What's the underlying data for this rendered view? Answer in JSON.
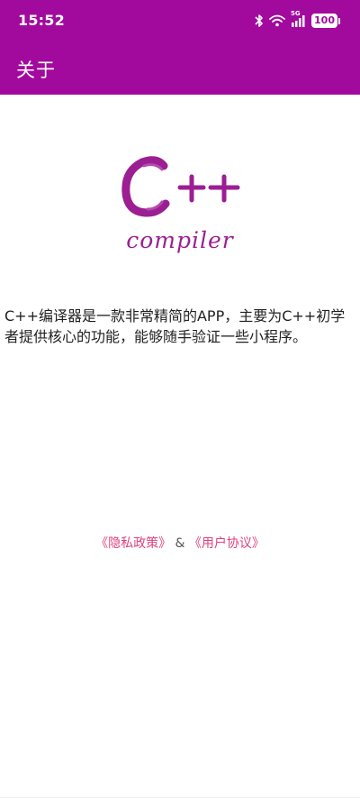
{
  "status_bar": {
    "time": "15:52",
    "network": "5G",
    "battery": "100",
    "icons": [
      "bluetooth-icon",
      "wifi-icon",
      "signal-icon",
      "battery-icon"
    ]
  },
  "app_bar": {
    "title": "关于",
    "background_color": "#a20a9e"
  },
  "logo": {
    "mark": "C++",
    "word": "compiler",
    "color": "#9b1f93"
  },
  "description": "C++编译器是一款非常精简的APP，主要为C++初学者提供核心的功能，能够随手验证一些小程序。",
  "links": {
    "privacy_policy": "《隐私政策》",
    "separator": "&",
    "user_agreement": "《用户协议》",
    "link_color": "#e0427e"
  }
}
